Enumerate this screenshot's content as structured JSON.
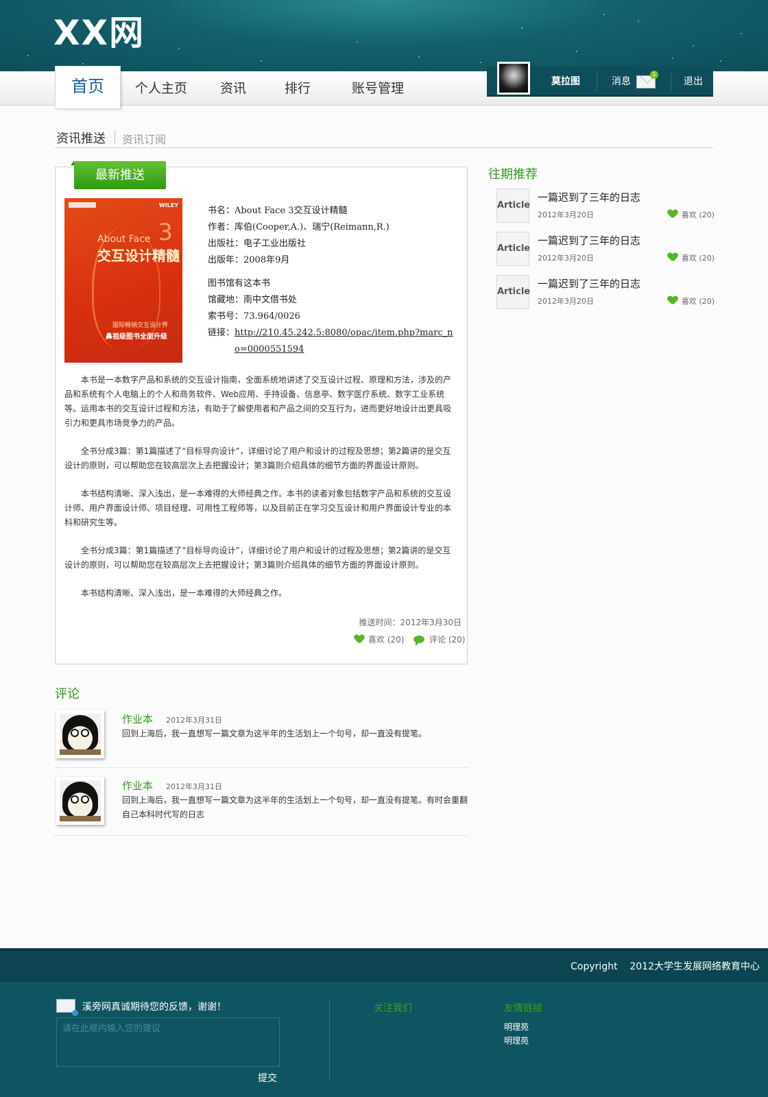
{
  "site": {
    "logo": "XX网"
  },
  "nav": {
    "items": [
      {
        "label": "首页",
        "active": true
      },
      {
        "label": "个人主页",
        "active": false
      },
      {
        "label": "资讯",
        "active": false
      },
      {
        "label": "排行",
        "active": false
      },
      {
        "label": "账号管理",
        "active": false
      }
    ]
  },
  "user": {
    "name": "莫拉图",
    "messages_label": "消息",
    "messages_count": "1",
    "logout_label": "退出"
  },
  "subtabs": {
    "active": "资讯推送",
    "inactive": "资讯订阅"
  },
  "card": {
    "ribbon": "最新推送",
    "cover": {
      "publisher_mark": "WILEY",
      "title_en": "About Face",
      "title_cn": "交互设计精髓",
      "edition": "3",
      "series": "国际畅销交互设计界",
      "upgrade": "鼻祖级图书全面升级"
    },
    "book": {
      "title": "书名：About Face 3交互设计精髓",
      "author": "作者：库伯(Cooper,A.)、瑞宁(Reimann,R.)",
      "publisher": "出版社：电子工业出版社",
      "year": "出版年：2008年9月",
      "library": "图书馆有这本书",
      "location": "馆藏地：南中文借书处",
      "callno": "索书号：73.964/0026",
      "link_label": "链接：",
      "link_url": "http://210.45.242.5:8080/opac/item.php?marc_no=0000551594"
    },
    "paragraphs": [
      "本书是一本数字产品和系统的交互设计指南，全面系统地讲述了交互设计过程、原理和方法，涉及的产品和系统有个人电脑上的个人和商务软件、Web应用、手持设备、信息亭、数字医疗系统、数字工业系统等。运用本书的交互设计过程和方法，有助于了解使用者和产品之间的交互行为，进而更好地设计出更具吸引力和更具市场竞争力的产品。",
      "全书分成3篇：第1篇描述了“目标导向设计”，详细讨论了用户和设计的过程及思想；第2篇讲的是交互设计的原则，可以帮助您在较高层次上去把握设计；第3篇则介绍具体的细节方面的界面设计原则。",
      "本书结构清晰、深入浅出，是一本难得的大师经典之作。本书的读者对象包括数字产品和系统的交互设计师、用户界面设计师、项目经理、可用性工程师等，以及目前正在学习交互设计和用户界面设计专业的本科和研究生等。",
      "全书分成3篇：第1篇描述了“目标导向设计”，详细讨论了用户和设计的过程及思想；第2篇讲的是交互设计的原则，可以帮助您在较高层次上去把握设计；第3篇则介绍具体的细节方面的界面设计原则。",
      "本书结构清晰、深入浅出，是一本难得的大师经典之作。"
    ],
    "push_time": "推送时间：2012年3月30日",
    "likes": "喜欢 (20)",
    "comments": "评论 (20)"
  },
  "recommend": {
    "title": "往期推荐",
    "items": [
      {
        "thumb": "Article",
        "title": "一篇迟到了三年的日志",
        "date": "2012年3月20日",
        "likes": "喜欢 (20)"
      },
      {
        "thumb": "Article",
        "title": "一篇迟到了三年的日志",
        "date": "2012年3月20日",
        "likes": "喜欢 (20)"
      },
      {
        "thumb": "Article",
        "title": "一篇迟到了三年的日志",
        "date": "2012年3月20日",
        "likes": "喜欢 (20)"
      }
    ]
  },
  "comments": {
    "title": "评论",
    "items": [
      {
        "name": "作业本",
        "date": "2012年3月31日",
        "text": "回到上海后，我一直想写一篇文章为这半年的生活划上一个句号，却一直没有提笔。"
      },
      {
        "name": "作业本",
        "date": "2012年3月31日",
        "text": "回到上海后，我一直想写一篇文章为这半年的生活划上一个句号，却一直没有提笔。有时会重翻自己本科时代写的日志"
      }
    ]
  },
  "footer": {
    "copyright": "Copyright    2012大学生发展网络教育中心",
    "feedback_text": "溪旁网真诚期待您的反馈，谢谢！",
    "feedback_placeholder": "请在此框内输入您的建议",
    "submit_label": "提交",
    "follow_title": "关注我们",
    "links_title": "友情链接",
    "links": [
      "明理苑",
      "明理苑"
    ]
  }
}
